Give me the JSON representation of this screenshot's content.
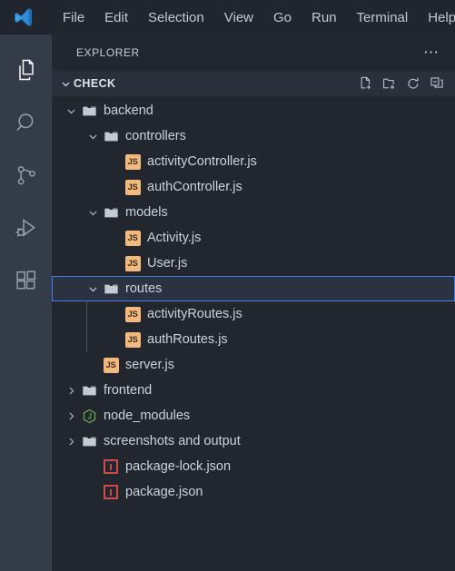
{
  "window": {
    "logo_icon": "vscode-logo",
    "menu": [
      {
        "label": "File"
      },
      {
        "label": "Edit"
      },
      {
        "label": "Selection"
      },
      {
        "label": "View"
      },
      {
        "label": "Go"
      },
      {
        "label": "Run"
      },
      {
        "label": "Terminal"
      },
      {
        "label": "Help"
      }
    ]
  },
  "activity_bar": {
    "items": [
      {
        "icon": "explorer-files-icon",
        "name": "explorer",
        "active": true
      },
      {
        "icon": "search-icon",
        "name": "search",
        "active": false
      },
      {
        "icon": "source-control-branch-icon",
        "name": "source-control",
        "active": false
      },
      {
        "icon": "run-and-debug-icon",
        "name": "run-debug",
        "active": false
      },
      {
        "icon": "extensions-blocks-icon",
        "name": "extensions",
        "active": false
      }
    ]
  },
  "sidebar": {
    "title": "EXPLORER",
    "overflow_icon": "ellipsis-icon",
    "section": {
      "name": "CHECK",
      "expanded": true,
      "chevron_icon": "chevron-down-icon",
      "actions": [
        {
          "icon": "new-file-icon",
          "label": "New File"
        },
        {
          "icon": "new-folder-icon",
          "label": "New Folder"
        },
        {
          "icon": "refresh-icon",
          "label": "Refresh Explorer"
        },
        {
          "icon": "collapse-all-icon",
          "label": "Collapse Folders in Explorer"
        }
      ]
    },
    "tree": [
      {
        "label": "backend",
        "kind": "folder",
        "icon": "folder-icon",
        "depth": 1,
        "state": "expanded",
        "selected": false
      },
      {
        "label": "controllers",
        "kind": "folder",
        "icon": "folder-icon",
        "depth": 2,
        "state": "expanded",
        "selected": false
      },
      {
        "label": "activityController.js",
        "kind": "file",
        "icon": "js-file-icon",
        "depth": 3,
        "state": "leaf",
        "selected": false
      },
      {
        "label": "authController.js",
        "kind": "file",
        "icon": "js-file-icon",
        "depth": 3,
        "state": "leaf",
        "selected": false
      },
      {
        "label": "models",
        "kind": "folder",
        "icon": "folder-icon",
        "depth": 2,
        "state": "expanded",
        "selected": false
      },
      {
        "label": "Activity.js",
        "kind": "file",
        "icon": "js-file-icon",
        "depth": 3,
        "state": "leaf",
        "selected": false
      },
      {
        "label": "User.js",
        "kind": "file",
        "icon": "js-file-icon",
        "depth": 3,
        "state": "leaf",
        "selected": false
      },
      {
        "label": "routes",
        "kind": "folder",
        "icon": "folder-icon",
        "depth": 2,
        "state": "expanded",
        "selected": true
      },
      {
        "label": "activityRoutes.js",
        "kind": "file",
        "icon": "js-file-icon",
        "depth": 3,
        "state": "leaf",
        "selected": false
      },
      {
        "label": "authRoutes.js",
        "kind": "file",
        "icon": "js-file-icon",
        "depth": 3,
        "state": "leaf",
        "selected": false
      },
      {
        "label": "server.js",
        "kind": "file",
        "icon": "js-file-icon",
        "depth": 2,
        "state": "leaf",
        "selected": false
      },
      {
        "label": "frontend",
        "kind": "folder",
        "icon": "folder-icon",
        "depth": 1,
        "state": "collapsed",
        "selected": false
      },
      {
        "label": "node_modules",
        "kind": "folder",
        "icon": "nodejs-icon",
        "depth": 1,
        "state": "collapsed",
        "selected": false
      },
      {
        "label": "screenshots and output",
        "kind": "folder",
        "icon": "folder-icon",
        "depth": 1,
        "state": "collapsed",
        "selected": false
      },
      {
        "label": "package-lock.json",
        "kind": "file",
        "icon": "npm-json-icon",
        "depth": 1,
        "state": "leaf",
        "selected": false
      },
      {
        "label": "package.json",
        "kind": "file",
        "icon": "npm-json-icon",
        "depth": 1,
        "state": "leaf",
        "selected": false
      }
    ]
  },
  "colors": {
    "titlebar_bg": "#21252e",
    "activitybar_bg": "#343b49",
    "sidebar_bg": "#22262e",
    "section_header_bg": "#2a303b",
    "selection_border": "#3f7ee8",
    "selection_bg": "#2b3240",
    "text": "#ccd2de",
    "js_icon": "#f3b97c",
    "npm_icon": "#cf4b4b",
    "node_icon": "#6aa84f",
    "folder_icon": "#c5c9d2"
  }
}
